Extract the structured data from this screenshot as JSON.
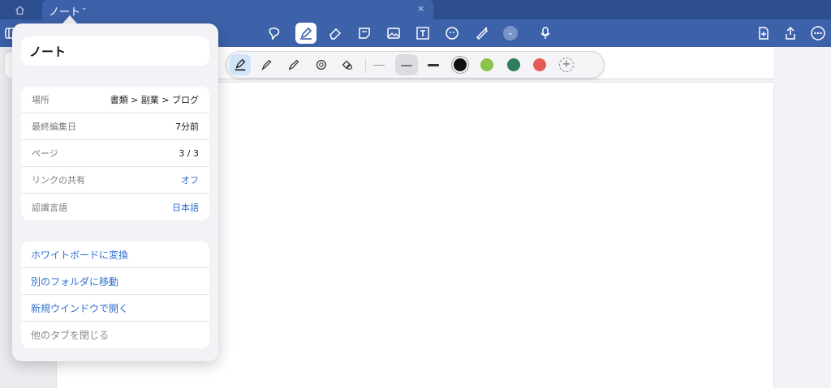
{
  "tabbar": {
    "home_icon": "home-icon",
    "tab_title": "ノート",
    "tab_chevron": "⌄",
    "tab_close": "×"
  },
  "toolbar": {
    "left_icon": "sidebar-icon",
    "tools": [
      "lasso-icon",
      "pen-icon",
      "eraser-icon",
      "sticky-note-icon",
      "image-icon",
      "text-box-icon",
      "sticker-icon",
      "tape-icon",
      "more-tools-icon",
      "microphone-icon"
    ],
    "active_tool": "pen-icon",
    "right_icons": [
      "add-page-icon",
      "share-icon",
      "more-icon"
    ]
  },
  "pen_palette": {
    "tools": [
      "fountain-pen",
      "ballpoint-pen",
      "brush-pen",
      "highlighter-shape",
      "shape-pen"
    ],
    "active_tool": "fountain-pen",
    "stroke_widths": [
      "thin",
      "medium",
      "thick"
    ],
    "selected_stroke": "medium",
    "colors": [
      "#111111",
      "#8bc34a",
      "#2e7d5b",
      "#e85a5a"
    ],
    "selected_color": "#111111",
    "add_color_label": "+"
  },
  "popover": {
    "name": "ノート",
    "info_rows": [
      {
        "label": "場所",
        "value": "書類 > 副業 > ブログ",
        "link": false
      },
      {
        "label": "最終編集日",
        "value": "7分前",
        "link": false
      },
      {
        "label": "ページ",
        "value": "3 / 3",
        "link": false
      },
      {
        "label": "リンクの共有",
        "value": "オフ",
        "link": true
      },
      {
        "label": "認識言語",
        "value": "日本語",
        "link": true
      }
    ],
    "actions": [
      {
        "label": "ホワイトボードに変換",
        "enabled": true
      },
      {
        "label": "別のフォルダに移動",
        "enabled": true
      },
      {
        "label": "新規ウインドウで開く",
        "enabled": true
      },
      {
        "label": "他のタブを閉じる",
        "enabled": false
      }
    ]
  }
}
